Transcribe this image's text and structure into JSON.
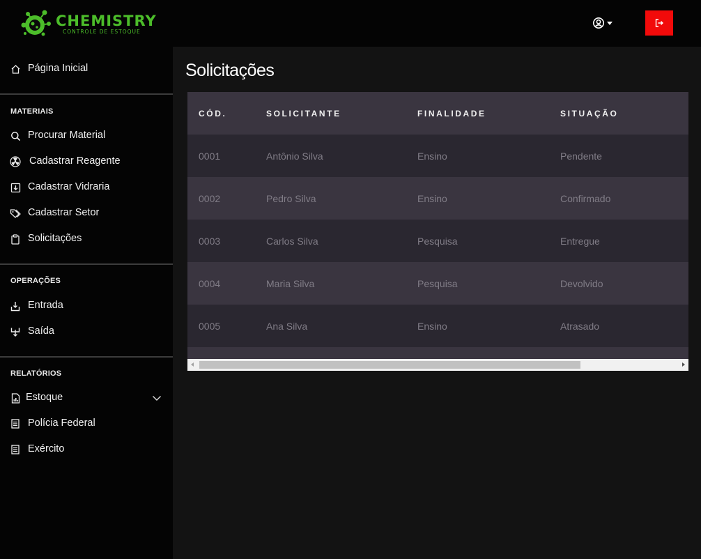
{
  "brand": {
    "name": "CHEMISTRY",
    "subtitle": "CONTROLE DE ESTOQUE",
    "color": "#4cbd2a"
  },
  "header": {
    "user_icon": "user-circle-icon",
    "logout_icon": "logout-icon",
    "logout_color": "#f20a0a"
  },
  "sidebar": {
    "home": {
      "label": "Página Inicial",
      "icon": "home-icon"
    },
    "sections": {
      "materiais": {
        "title": "MATERIAIS",
        "items": [
          {
            "label": "Procurar Material",
            "icon": "search-icon"
          },
          {
            "label": "Cadastrar Reagente",
            "icon": "radiation-icon"
          },
          {
            "label": "Cadastrar Vidraria",
            "icon": "download-box-icon"
          },
          {
            "label": "Cadastrar Setor",
            "icon": "tags-icon"
          },
          {
            "label": "Solicitações",
            "icon": "clipboard-icon"
          }
        ]
      },
      "operacoes": {
        "title": "OPERAÇÕES",
        "items": [
          {
            "label": "Entrada",
            "icon": "inbox-in-icon"
          },
          {
            "label": "Saída",
            "icon": "inbox-out-icon"
          }
        ]
      },
      "relatorios": {
        "title": "RELATÓRIOS",
        "items": [
          {
            "label": "Estoque",
            "icon": "report-chart-icon"
          },
          {
            "label": "Polícia Federal",
            "icon": "document-icon"
          },
          {
            "label": "Exército",
            "icon": "document-icon"
          }
        ]
      }
    }
  },
  "main": {
    "title": "Solicitações",
    "table": {
      "headers": [
        "CÓD.",
        "SOLICITANTE",
        "FINALIDADE",
        "SITUAÇÃO"
      ],
      "rows": [
        [
          "0001",
          "Antônio Silva",
          "Ensino",
          "Pendente"
        ],
        [
          "0002",
          "Pedro Silva",
          "Ensino",
          "Confirmado"
        ],
        [
          "0003",
          "Carlos Silva",
          "Pesquisa",
          "Entregue"
        ],
        [
          "0004",
          "Maria Silva",
          "Pesquisa",
          "Devolvido"
        ],
        [
          "0005",
          "Ana Silva",
          "Ensino",
          "Atrasado"
        ]
      ]
    }
  }
}
